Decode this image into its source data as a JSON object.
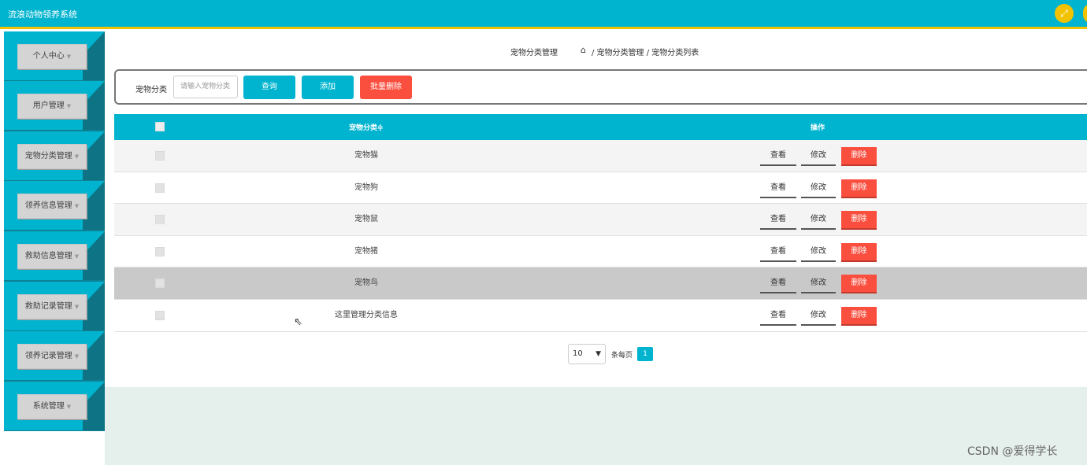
{
  "app": {
    "title": "流浪动物领养系统"
  },
  "header": {
    "fullscreen_icon": "fullscreen-icon"
  },
  "sidebar": {
    "items": [
      {
        "label": "个人中心"
      },
      {
        "label": "用户管理"
      },
      {
        "label": "宠物分类管理"
      },
      {
        "label": "领养信息管理"
      },
      {
        "label": "救助信息管理"
      },
      {
        "label": "救助记录管理"
      },
      {
        "label": "领养记录管理"
      },
      {
        "label": "系统管理"
      }
    ]
  },
  "breadcrumb": {
    "title": "宠物分类管理",
    "path": "/ 宠物分类管理 / 宠物分类列表"
  },
  "search": {
    "label": "宠物分类",
    "placeholder": "请输入宠物分类",
    "query_label": "查询",
    "add_label": "添加",
    "batch_delete_label": "批量删除"
  },
  "table": {
    "headers": {
      "category": "宠物分类≑",
      "operation": "操作"
    },
    "rows": [
      {
        "category": "宠物猫"
      },
      {
        "category": "宠物狗"
      },
      {
        "category": "宠物鼠"
      },
      {
        "category": "宠物猪"
      },
      {
        "category": "宠物鸟"
      },
      {
        "category": "这里管理分类信息"
      }
    ],
    "actions": {
      "view": "查看",
      "edit": "修改",
      "delete": "删除"
    }
  },
  "pager": {
    "page_size": "10",
    "per_page_label": "条每页",
    "current_page": "1"
  },
  "watermark": "CSDN @爱得学长",
  "colors": {
    "primary": "#00b4cf",
    "danger": "#fa4e3e",
    "accent": "#f2c200",
    "sidebar": "#0f8194"
  }
}
